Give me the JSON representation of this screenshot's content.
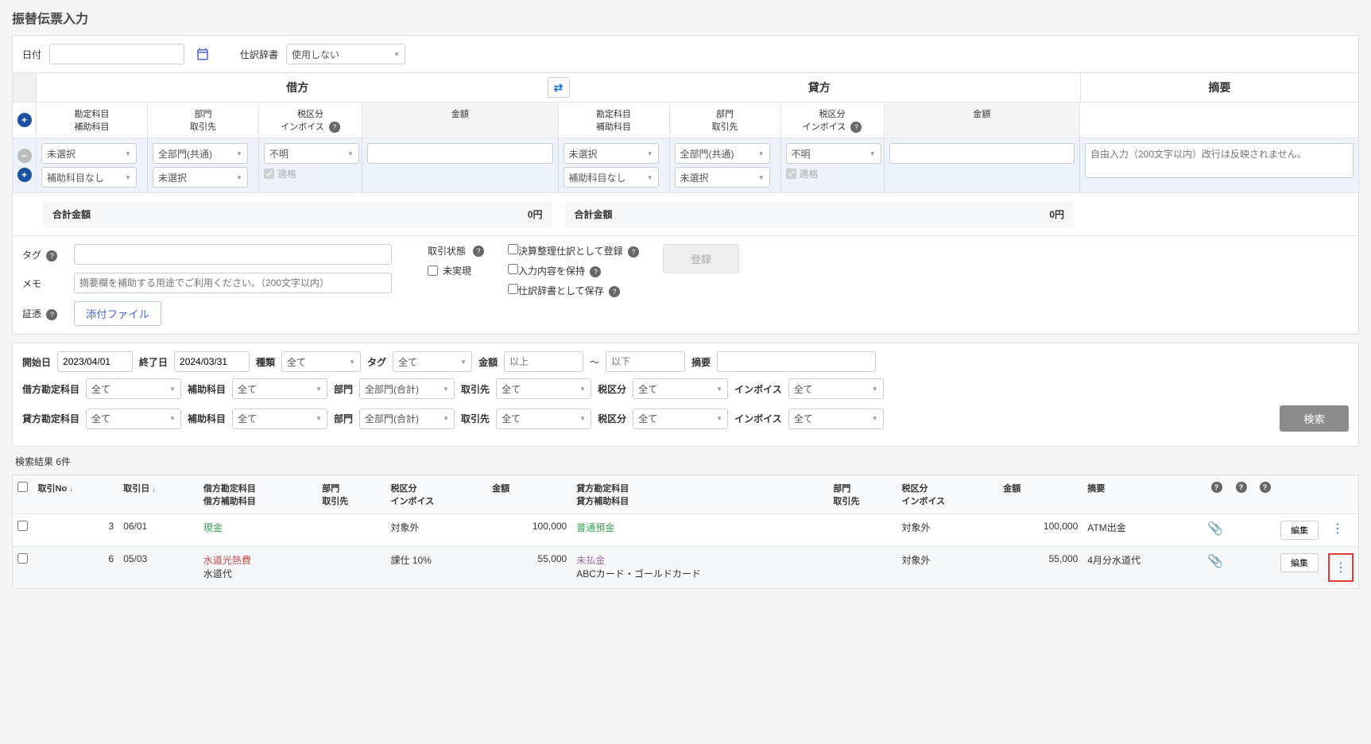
{
  "page_title": "振替伝票入力",
  "top": {
    "date_label": "日付",
    "dict_label": "仕訳辞書",
    "dict_value": "使用しない"
  },
  "headers": {
    "debit": "借方",
    "credit": "貸方",
    "summary": "摘要",
    "account": "勘定科目",
    "sub_account": "補助科目",
    "dept": "部門",
    "partner": "取引先",
    "tax": "税区分",
    "invoice": "インボイス",
    "amount": "金額"
  },
  "row": {
    "account_unselected": "未選択",
    "sub_none": "補助科目なし",
    "dept_all": "全部門(共通)",
    "partner_unselected": "未選択",
    "tax_unknown": "不明",
    "qualified": "適格",
    "summary_placeholder": "自由入力（200文字以内）改行は反映されません。"
  },
  "totals": {
    "label": "合計金額",
    "debit": "0円",
    "credit": "0円"
  },
  "footer": {
    "tag_label": "タグ",
    "memo_label": "メモ",
    "memo_placeholder": "摘要欄を補助する用途でご利用ください。（200文字以内）",
    "evidence_label": "証憑",
    "attach_btn": "添付ファイル",
    "status_label": "取引状態",
    "unrealized": "未実現",
    "opt1": "決算整理仕訳として登録",
    "opt2": "入力内容を保持",
    "opt3": "仕訳辞書として保存",
    "register": "登録"
  },
  "filter": {
    "start_label": "開始日",
    "start_value": "2023/04/01",
    "end_label": "終了日",
    "end_value": "2024/03/31",
    "type_label": "種類",
    "type_value": "全て",
    "tag_label": "タグ",
    "tag_value": "全て",
    "amount_label": "金額",
    "amount_from_ph": "以上",
    "amount_to_ph": "以下",
    "amount_sep": "～",
    "summary_label": "摘要",
    "debit_acc_label": "借方勘定科目",
    "all": "全て",
    "sub_label": "補助科目",
    "dept_label": "部門",
    "dept_value": "全部門(合計)",
    "partner_label": "取引先",
    "tax_label": "税区分",
    "invoice_label": "インボイス",
    "credit_acc_label": "貸方勘定科目",
    "search_btn": "検索"
  },
  "results_count": "検索結果 6件",
  "cols": {
    "no": "取引No",
    "date": "取引日",
    "d_acc": "借方勘定科目",
    "d_sub": "借方補助科目",
    "dept": "部門",
    "partner": "取引先",
    "tax": "税区分",
    "invoice": "インボイス",
    "amount": "金額",
    "c_acc": "貸方勘定科目",
    "c_sub": "貸方補助科目",
    "summary": "摘要",
    "edit": "編集"
  },
  "rows": [
    {
      "no": "3",
      "date": "06/01",
      "d_acc": "現金",
      "d_sub": "",
      "d_dept": "",
      "d_partner": "",
      "d_tax": "対象外",
      "d_invoice": "",
      "d_amount": "100,000",
      "c_acc": "普通預金",
      "c_sub": "",
      "c_dept": "",
      "c_partner": "",
      "c_tax": "対象外",
      "c_invoice": "",
      "c_amount": "100,000",
      "summary": "ATM出金"
    },
    {
      "no": "6",
      "date": "05/03",
      "d_acc": "水道光熱費",
      "d_sub": "水道代",
      "d_dept": "",
      "d_partner": "",
      "d_tax": "課仕 10%",
      "d_invoice": "",
      "d_amount": "55,000",
      "c_acc": "未払金",
      "c_sub": "ABCカード・ゴールドカード",
      "c_dept": "",
      "c_partner": "",
      "c_tax": "対象外",
      "c_invoice": "",
      "c_amount": "55,000",
      "summary": "4月分水道代"
    }
  ]
}
